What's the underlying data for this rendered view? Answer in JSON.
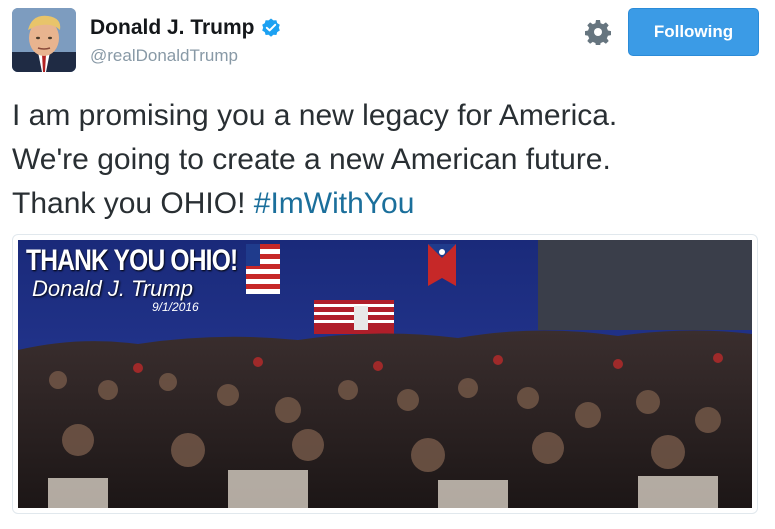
{
  "author": {
    "display_name": "Donald J. Trump",
    "handle": "@realDonaldTrump",
    "verified": true
  },
  "actions": {
    "follow_label": "Following",
    "settings_icon": "gear-icon"
  },
  "tweet": {
    "lines": [
      "I am promising you a new legacy for America.",
      "We're going to create a new American future.",
      "Thank you OHIO! "
    ],
    "hashtag": "#ImWithYou"
  },
  "media": {
    "overlay_title": "THANK YOU OHIO!",
    "overlay_name": "Donald J. Trump",
    "overlay_date": "9/1/2016"
  },
  "colors": {
    "follow_button": "#3b9be6",
    "hashtag": "#1b6f9b",
    "handle": "#8899a6",
    "verified": "#1da1f2"
  }
}
